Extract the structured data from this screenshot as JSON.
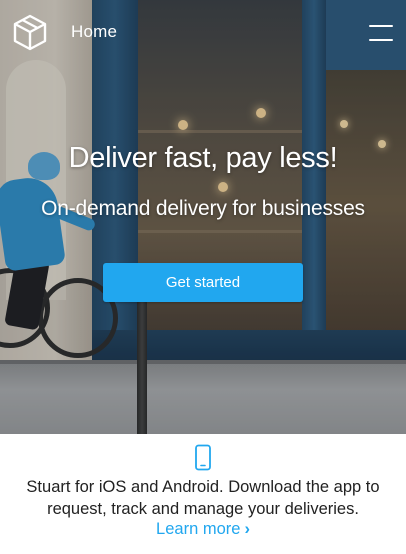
{
  "header": {
    "logo_icon": "box-logo-icon",
    "home_label": "Home",
    "menu_icon": "hamburger-menu-icon"
  },
  "hero": {
    "headline": "Deliver fast, pay less!",
    "subheadline": "On-demand delivery for businesses",
    "cta_label": "Get started",
    "cta_color": "#21a7ef",
    "background_image": "cyclist-in-front-of-blue-storefront"
  },
  "app_promo": {
    "icon": "smartphone-icon",
    "text": "Stuart for iOS and Android. Download the app to request, track and manage your deliveries.",
    "link_label": "Learn more",
    "link_icon": "chevron-right-icon",
    "link_color": "#21a7ef"
  }
}
